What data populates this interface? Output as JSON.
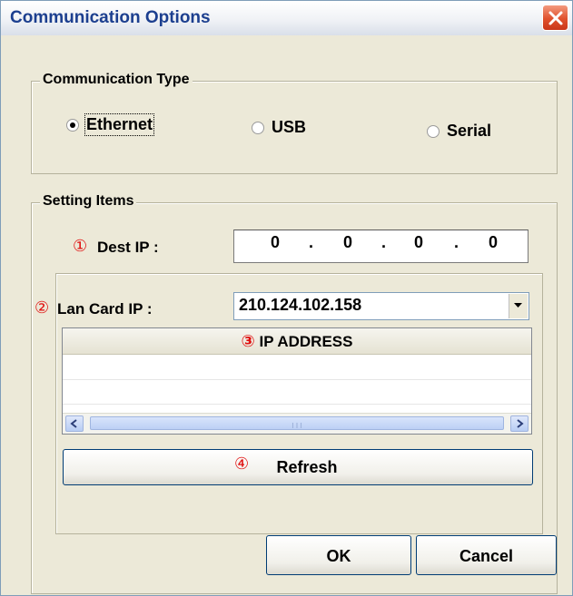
{
  "window": {
    "title": "Communication Options"
  },
  "communication_type": {
    "label": "Communication Type",
    "options": [
      {
        "label": "Ethernet",
        "selected": true
      },
      {
        "label": "USB",
        "selected": false
      },
      {
        "label": "Serial",
        "selected": false
      }
    ]
  },
  "setting_items": {
    "label": "Setting Items",
    "dest_ip": {
      "marker": "①",
      "label": "Dest IP :",
      "octets": [
        "0",
        ".",
        "0",
        ".",
        "0",
        ".",
        "0"
      ]
    },
    "lan_card_ip": {
      "marker": "②",
      "label": "Lan Card IP :",
      "value": "210.124.102.158"
    },
    "ip_list": {
      "marker": "③",
      "header": "IP ADDRESS",
      "rows": []
    },
    "refresh": {
      "marker": "④",
      "label": "Refresh"
    }
  },
  "buttons": {
    "ok": "OK",
    "cancel": "Cancel"
  }
}
